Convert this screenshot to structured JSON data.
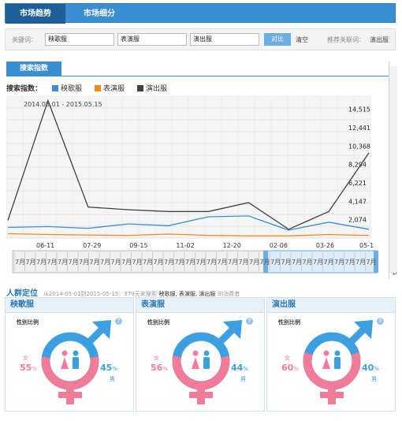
{
  "tabs": [
    {
      "label": "市场趋势"
    },
    {
      "label": "市场细分"
    }
  ],
  "search": {
    "keyword_label": "关键词：",
    "keywords": [
      "秧歌服",
      "表演服",
      "演出服"
    ],
    "compare_label": "对比",
    "clear_label": "清空",
    "related_label": "推荐关联词：",
    "related_value": "演出服"
  },
  "subtab": {
    "label": "搜索指数"
  },
  "legend": {
    "title": "搜索指数：",
    "items": [
      "秧歌服",
      "表演服",
      "演出服"
    ]
  },
  "colors": {
    "blue": "#3a8fd2",
    "orange": "#f08a1c",
    "dark": "#404040",
    "pink": "#f07c9a",
    "male": "#3b9fe0"
  },
  "chart_data": {
    "type": "line",
    "title": "2014.05.01 - 2015.05.15",
    "x": [
      "05-01",
      "06-11",
      "07-29",
      "09-15",
      "11-02",
      "12-20",
      "02-06",
      "03-26",
      "05-15"
    ],
    "x_tick_labels": [
      "06-11",
      "07-29",
      "09-15",
      "11-02",
      "12-20",
      "02-06",
      "03-26",
      "05-1"
    ],
    "y_tick_labels": [
      "14,515",
      "12,441",
      "10,368",
      "8,294",
      "6,221",
      "4,147",
      "2,074"
    ],
    "ylim": [
      0,
      16000
    ],
    "series": [
      {
        "name": "秧歌服",
        "values": [
          1200,
          1300,
          1100,
          1600,
          1400,
          2400,
          2500,
          900,
          1800,
          1000
        ]
      },
      {
        "name": "表演服",
        "values": [
          500,
          400,
          350,
          300,
          450,
          300,
          250,
          250,
          400,
          300
        ]
      },
      {
        "name": "演出服",
        "values": [
          2000,
          15500,
          3500,
          3200,
          3000,
          3000,
          4000,
          1000,
          3000,
          9600
        ]
      }
    ],
    "grid": true
  },
  "timeline": {
    "label": "7月"
  },
  "people": {
    "title": "人群定位",
    "desc": "从2014-05-01到2015-05-15，379天来搜索",
    "terms": "秧歌服, 表演服, 演出服",
    "suffix": "的消费者"
  },
  "panels": [
    {
      "name": "秧歌服",
      "gender_label": "性别比例",
      "female": "55",
      "male": "45",
      "female_word": "女",
      "male_word": "男",
      "female_frac": 0.55
    },
    {
      "name": "表演服",
      "gender_label": "性别比例",
      "female": "56",
      "male": "44",
      "female_word": "女",
      "male_word": "男",
      "female_frac": 0.56
    },
    {
      "name": "演出服",
      "gender_label": "性别比例",
      "female": "60",
      "male": "40",
      "female_word": "女",
      "male_word": "男",
      "female_frac": 0.6
    }
  ]
}
